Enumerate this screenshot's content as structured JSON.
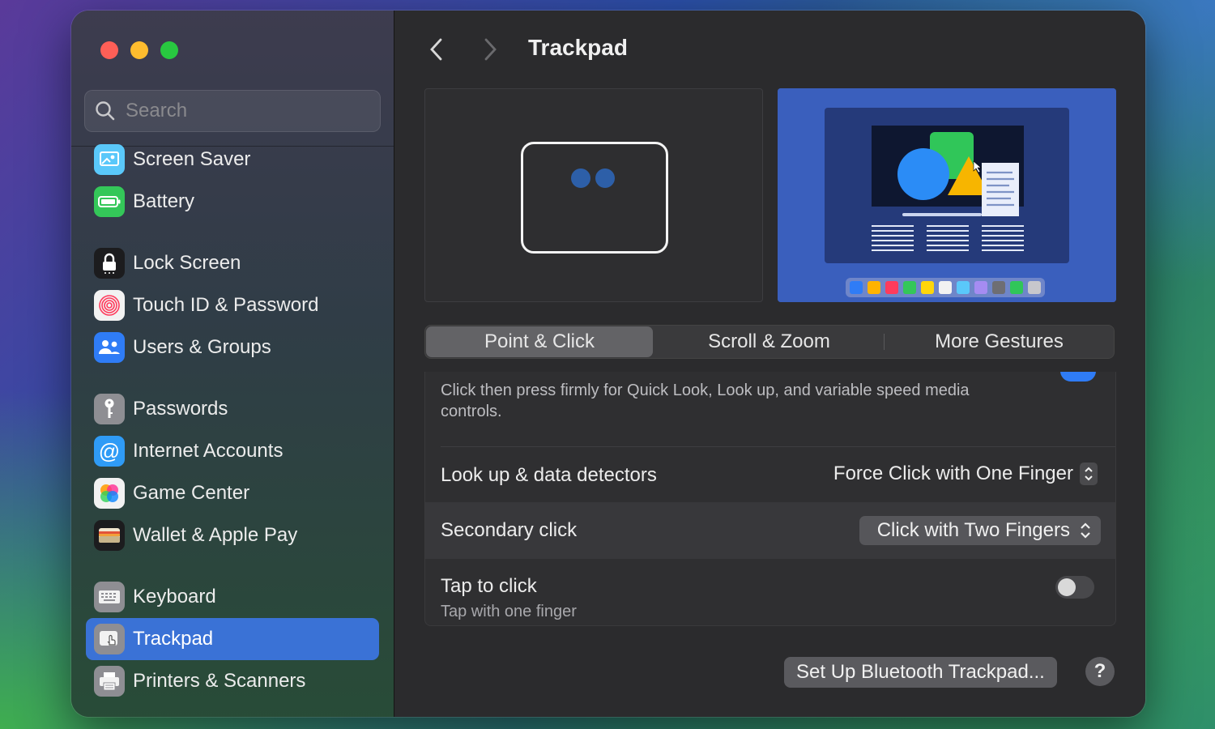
{
  "search": {
    "placeholder": "Search"
  },
  "sidebar": {
    "items": [
      {
        "label": "Screen Saver",
        "icon": "screen-saver-icon",
        "color": "#5ac8fa"
      },
      {
        "label": "Battery",
        "icon": "battery-icon",
        "color": "#34c759"
      },
      {
        "label": "Lock Screen",
        "icon": "lock-icon",
        "color": "#1c1c1e"
      },
      {
        "label": "Touch ID & Password",
        "icon": "fingerprint-icon",
        "color": "#f2f2f2"
      },
      {
        "label": "Users & Groups",
        "icon": "users-icon",
        "color": "#2f7cf6"
      },
      {
        "label": "Passwords",
        "icon": "key-icon",
        "color": "#8e8e93"
      },
      {
        "label": "Internet Accounts",
        "icon": "at-icon",
        "color": "#2f9bf6"
      },
      {
        "label": "Game Center",
        "icon": "game-center-icon",
        "color": "#f2f2f2"
      },
      {
        "label": "Wallet & Apple Pay",
        "icon": "wallet-icon",
        "color": "#1c1c1e"
      },
      {
        "label": "Keyboard",
        "icon": "keyboard-icon",
        "color": "#8e8e93"
      },
      {
        "label": "Trackpad",
        "icon": "trackpad-icon",
        "color": "#8e8e93",
        "selected": true
      },
      {
        "label": "Printers & Scanners",
        "icon": "printer-icon",
        "color": "#8e8e93"
      }
    ]
  },
  "header": {
    "title": "Trackpad"
  },
  "tabs": [
    {
      "label": "Point & Click",
      "active": true
    },
    {
      "label": "Scroll & Zoom",
      "active": false
    },
    {
      "label": "More Gestures",
      "active": false
    }
  ],
  "settings": {
    "force_click_desc": "Click then press firmly for Quick Look, Look up, and variable speed media controls.",
    "lookup": {
      "label": "Look up & data detectors",
      "value": "Force Click with One Finger"
    },
    "secondary": {
      "label": "Secondary click",
      "value": "Click with Two Fingers"
    },
    "tap": {
      "label": "Tap to click",
      "sublabel": "Tap with one finger",
      "enabled": false
    }
  },
  "footer": {
    "bt_button": "Set Up Bluetooth Trackpad...",
    "help": "?"
  },
  "colors": {
    "accent": "#3a72d6",
    "preview_bg": "#3a5fbd"
  }
}
